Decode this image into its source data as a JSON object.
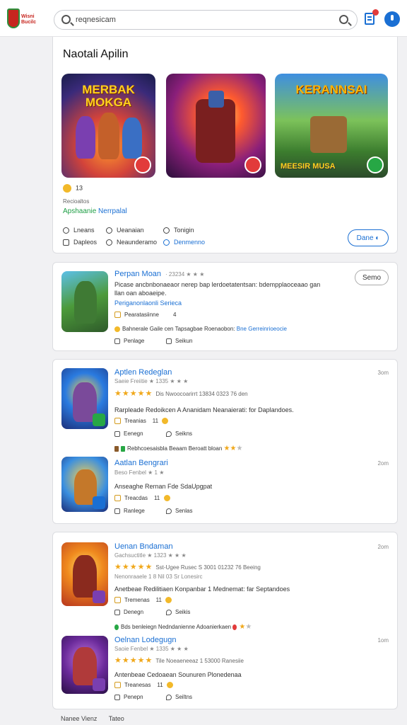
{
  "header": {
    "logo_text": "Wisni Bucilc",
    "search_value": "reqnesicam"
  },
  "featured": {
    "title": "Naotali Apilin",
    "banners": [
      {
        "text": "MERBAK MOKGA",
        "bottom_text": ""
      },
      {
        "text": "",
        "bottom_text": ""
      },
      {
        "text": "KERANNSAI",
        "bottom_text": "MEESIR MUSA"
      }
    ],
    "rating": "13",
    "small_text": "Recioaltos",
    "green_text": "Apshaanie",
    "blue_text": "Nerrpalal",
    "options": [
      "Lneans",
      "Ueanaian",
      "Tonigin",
      "Dapleos",
      "Neaunderamo",
      "Denmenno"
    ],
    "done_label": "Dane ◐"
  },
  "app1": {
    "title": "Perpan Moan",
    "meta": "· 23234 ★ ★ ★",
    "desc": "Picase ancbnbonaeaor nerep bap lerdoetatentsan: bdempplaoceaao gan llan oan aboaeipe.",
    "blue_line": "Periganonlaonli Serieca",
    "stat": "Pearatasiinne",
    "stat_num": "4",
    "feature": "Bahnerale Gaile cen Tapsagbae Roenaobon:",
    "feature_blue": "Bne Gerreinrioeocie",
    "act1": "Penlage",
    "act2": "Seikun",
    "save_label": "Semo"
  },
  "app2": {
    "title": "Aptlen Redeglan",
    "time": "3om",
    "sub": "Saeie Freiitie ★ 1335 ★ ★ ★",
    "stars": "★★★★★",
    "stars_text": "Dis Nwoocoarirrt 13834 0323 76 den",
    "desc": "Rarpleade Redoikcen A Ananidam Neanaierati: for Daplandoes.",
    "stat": "Treanias",
    "stat_num": "11",
    "act1": "Eenegn",
    "act2": "Seikns",
    "strip": "Rebhcoesaisbla Beaam Beroatt bloan"
  },
  "app3": {
    "title": "Aatlan Bengrari",
    "time": "2om",
    "sub": "Beso Fenbel ★ 1 ★",
    "desc": "Anseaghe Rernan Fde SdaUpgpat",
    "stat": "Treacdas",
    "stat_num": "11",
    "act1": "Ranlege",
    "act2": "Senlas"
  },
  "app4": {
    "title": "Uenan Bndaman",
    "time": "2om",
    "sub": "Gachsuctitle ★ 1323 ★ ★ ★",
    "stars": "★★★★★",
    "stars_text": "Sst-Ugee Rusec S 3001 01232 76 Beeing",
    "sub2": "Nenonraaele        1 8 Nil 03 Sr Lonesirc",
    "desc": "Anetbeae Redilitiaen Konpanbar 1 Mednemat: far Septandoes",
    "stat": "Tremenas",
    "stat_num": "11",
    "act1": "Denegn",
    "act2": "Seikis",
    "strip": "Bds benleiegn Nedndanienne Adoanierkaen"
  },
  "app5": {
    "title": "Oelnan Lodegugn",
    "time": "1om",
    "sub": "Saoie Fenbel ★ 1335 ★ ★ ★",
    "stars": "★★★★★",
    "stars_text": "Tile Noeaeneeaz 1 53000 Ranesiie",
    "desc": "Antenbeae Cedoaean Sounuren Plonedenaa",
    "stat": "Treanesas",
    "stat_num": "11",
    "act1": "Penepn",
    "act2": "Seiltns"
  },
  "footer": [
    "Nanee Vienz",
    "Tateo"
  ]
}
